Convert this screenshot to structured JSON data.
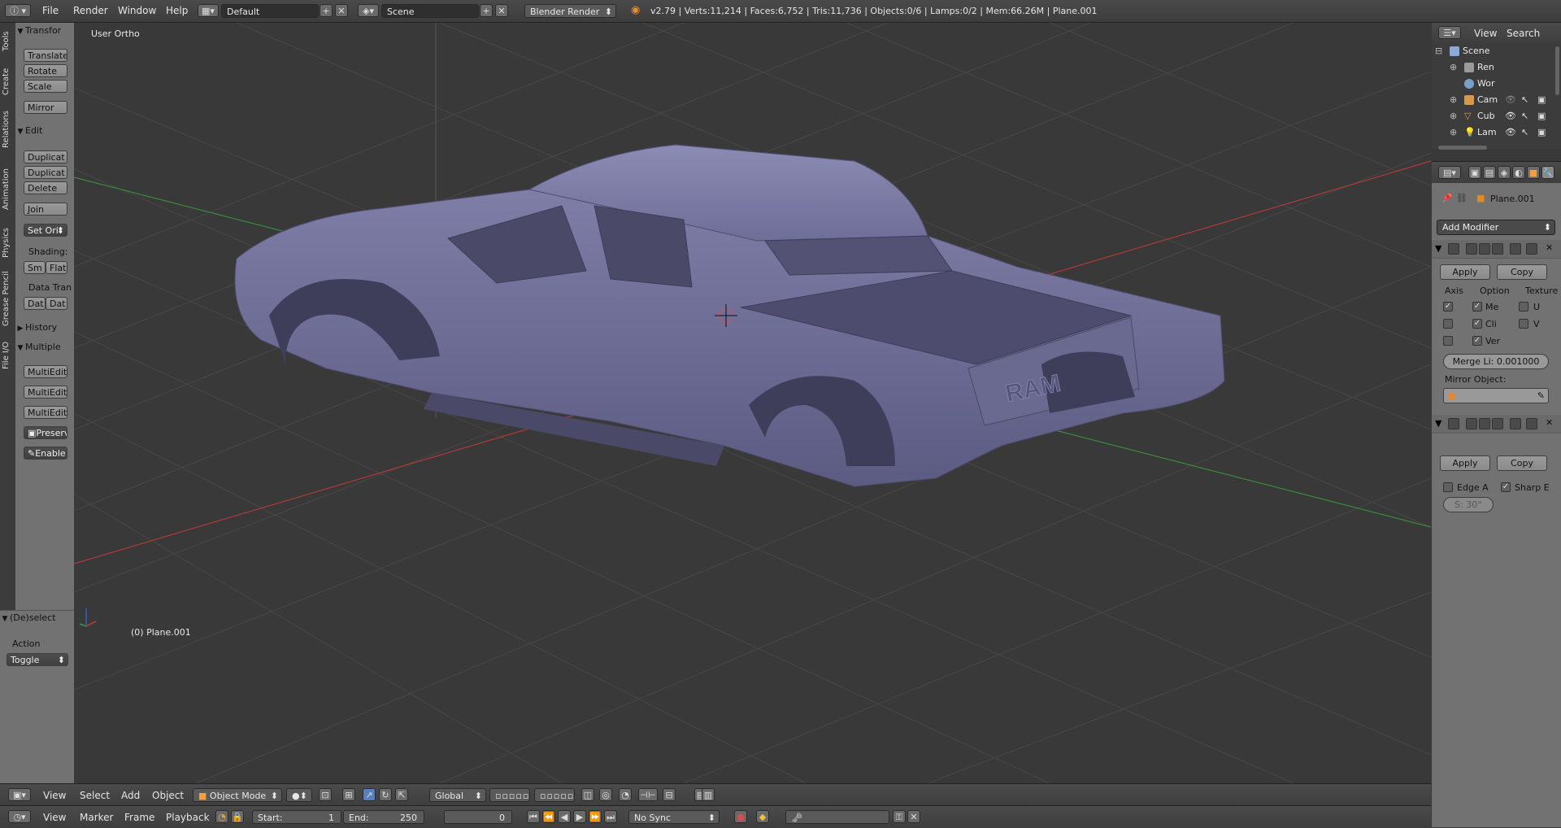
{
  "topbar": {
    "menus": [
      "File",
      "Render",
      "Window",
      "Help"
    ],
    "layout": "Default",
    "scene": "Scene",
    "engine": "Blender Render",
    "stats": "v2.79 | Verts:11,214 | Faces:6,752 | Tris:11,736 | Objects:0/6 | Lamps:0/2 | Mem:66.26M | Plane.001"
  },
  "tabs": [
    "Tools",
    "Create",
    "Relations",
    "Animation",
    "Physics",
    "Grease Pencil",
    "File I/O"
  ],
  "toolshelf": {
    "transform_header": "Transfor",
    "translate": "Translate",
    "rotate": "Rotate",
    "scale": "Scale",
    "mirror": "Mirror",
    "edit_header": "Edit",
    "duplicate1": "Duplicat",
    "duplicate2": "Duplicat",
    "delete": "Delete",
    "join": "Join",
    "set_origin": "Set Ori",
    "shading_label": "Shading:",
    "smooth": "Sm",
    "flat": "Flat",
    "data_transfer_label": "Data Tran",
    "dat1": "Dat",
    "dat2": "Dat",
    "history_header": "History",
    "multiedit_header": "Multiple",
    "multiedit1": "MultiEdit",
    "multiedit2": "MultiEdit",
    "multiedit3": "MultiEdit",
    "preserve": "Preserv",
    "enable": "Enable"
  },
  "last_operator": {
    "header": "(De)select",
    "action_label": "Action",
    "action_value": "Toggle"
  },
  "viewport": {
    "view_name": "User Ortho",
    "object_label": "(0) Plane.001",
    "truck_badge": "RAM"
  },
  "view3d_header": {
    "menus": [
      "View",
      "Select",
      "Add",
      "Object"
    ],
    "mode": "Object Mode",
    "orientation": "Global"
  },
  "timeline_header": {
    "menus": [
      "View",
      "Marker",
      "Frame",
      "Playback"
    ],
    "start_label": "Start:",
    "start_value": "1",
    "end_label": "End:",
    "end_value": "250",
    "current_frame": "0",
    "sync": "No Sync"
  },
  "outliner": {
    "menus": [
      "View",
      "Search"
    ],
    "rows": [
      {
        "label": "Scene",
        "color": "#8aa9d8"
      },
      {
        "label": "Ren",
        "color": "#9a9a9a"
      },
      {
        "label": "Wor",
        "color": "#7aa0c8"
      },
      {
        "label": "Cam",
        "color": "#d89a4a"
      },
      {
        "label": "Cub",
        "color": "#d8a050"
      },
      {
        "label": "Lam",
        "color": "#e0c060"
      }
    ]
  },
  "properties": {
    "object_name": "Plane.001",
    "add_modifier": "Add Modifier",
    "mirror": {
      "apply": "Apply",
      "copy": "Copy",
      "axis_label": "Axis",
      "option_label": "Option",
      "texture_label": "Texture",
      "opt_merge": "Me",
      "opt_clip": "Cli",
      "opt_vertex": "Ver",
      "tex_u": "U",
      "tex_v": "V",
      "merge_limit": "Merge Li: 0.001000",
      "mirror_object_label": "Mirror Object:"
    },
    "edge_split": {
      "apply": "Apply",
      "copy": "Copy",
      "edge_angle": "Edge A",
      "sharp_edges": "Sharp E",
      "angle_value": "S: 30°"
    }
  },
  "colors": {
    "viewport_bg": "#393939",
    "panel_bg": "#727272",
    "truck": "#6f6e98",
    "x_axis": "#b03a3a",
    "y_axis": "#3a8a3a"
  }
}
